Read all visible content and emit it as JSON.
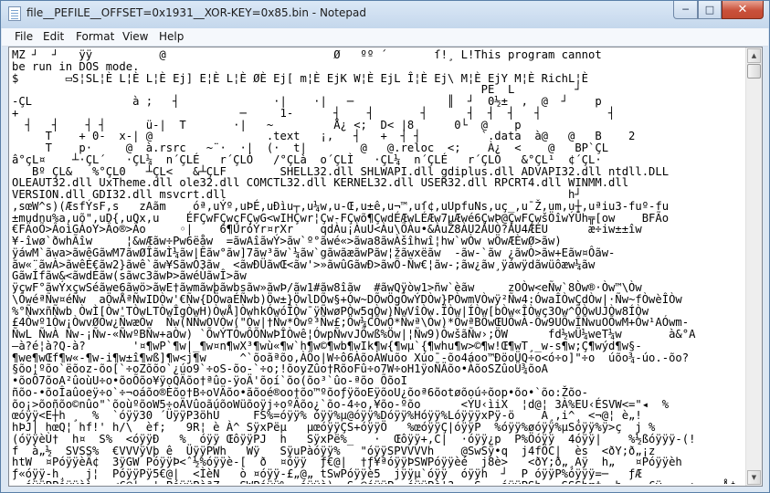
{
  "window": {
    "title": "file__PEFILE__OFFSET=0x1931__XOR-KEY=0x85.bin - Notepad",
    "controls": {
      "minimize": "─",
      "maximize": "□",
      "close": "✕"
    }
  },
  "menu": [
    "File",
    "Edit",
    "Format",
    "View",
    "Help"
  ],
  "document": {
    "lines": [
      "MZ ┘  ┘   ÿÿ          @                         Ø   ºº ´       ſ!¸ L!This program cannot",
      "be run in DOS mode.",
      "$       ▭S¦SL¦È L¦È L¦È Ej] E¦È L¦È ØÈ Ej[ m¦È EjK W¦È EjL Î¦È Ej\\ M¦È EjY M¦È RichL¦È",
      "                                                                      PE  L         ┘",
      "-ÇL               à ;   ┤              ·|    ·|   ─              ║  ┘  0½±  ,  @  ┘    p",
      "+                                 ─     1-      ┤    ┤       ┤      ┤  ┤  ┤   ┤          ┤",
      "  ┤   ┤    ┤ ┤      ü-|  T       ·|   ~         Å¿ <;  D< |8      0└  @    p",
      "     T    + 0-  x-| @                 .text   ¡,   ┤   +  ┤ ┤         `.data  à@   @   B    2",
      "     T    p·     @  à.rsrc   ~¨·  ·|  (·  t|        @   @.reloc  <;    À¿  <    @   BP`ÇL",
      "â°çL¤    ┴·ÇL´   ·ÇL¼  n´ÇLÉ   r´ÇLÓ   /°ÇLà  o´ÇLÌ   ·ÇL¼  n´ÇLÉ   r´ÇLÓ   &°ÇL¹  ¢´ÇL·",
      "   Bº ÇL&   %°ÇL0   ┴ÇL<   &┴ÇLF        SHELL32.dll SHLWAPI.dll gdiplus.dll ADVAPI32.dll ntdll.DLL",
      "OLEAUT32.dll UxTheme.dll ole32.dll COMCTL32.dll KERNEL32.dll USER32.dll RPCRT4.dll WINMM.dll",
      "VERSION.dll GDI32.dll msvcrt.dll                                                   h┘",
      ",sœW^s)(ÆsfÝsF,s   zAãm    óª,uÝº,uÞÉ,uÐìu┬,u¼w,u-Œ,u±ê,u¬™,uſ¢,uUpfuNs,uç_,u¯Ž,um,u┼,uªiu3-fuº-fu",
      "±mudnu%a,uõ\",uD{,uQx,u    ÉFÇwFÇwçFÇwG<wIHÇwr¦Çw-FÇwõ¶ÇwdÉÆwLÉÆw7µÆwé6ÇwÞ@ÇwFÇwšÖîwÝÜh╦[ow    BFÃo",
      "€FÄoÕ>ÂoìGÁoY>Âo®>Âo     ◦|    6¶UróÝr¤rXr    qdÀu¡ÀuU<Àu\\ÕÀu•&ÀuŽ8ÀU2ÀUÒ?ÀU4ÆÉU      æ÷iw±±îw",
      "¥-îwø`ðwhÃîw     ¦&wÆãw÷Pw6ëåw  =ãwAîãwÝ>ãw`º°ãwé«>ãwa8ãwÀšîhwî¦hw`wÒw wÖwÆÈwØ>ãw)",
      "ÿáwM`ãwa>ãwêGãwM7ãwØÎãwÌ¼ãw|Êãw°ãw]7ãw³ãw`¼ãw`gãwãæãwPãw¦žãwxëãw  -ãw-`ãw ¿ãwÒ>ãw+Eãw¤Ôãw-",
      "ãw«¨ãwÀ>ãwêÉ€ãw2}ãwê`ãw¥SãwÓ3ãw  <ãwÐÜãwŒ<ãw'>»ãwûGãwÐ>ãwÕ-Ñw€¦ãw-;ãw¿ãw¸ÿáwÿdãwüôæw¼ãw",
      "GãwÍfãw&<ãwdÉãw(sãwc3ãwÞ>ãwéÙãwÎ>ãw",
      "ÿçwF°ãwÝxçwSéãwe6ãwö>ãwE†ãwmãwþãwbsãw»ãwÞ/ãw1#ãw8îãw  #ãwQÿòw1>ñw`èãw     zOÒw<eÑw`8Òw®·Òw™\\Òw",
      "\\ÔwéªÑw¤éÑw  aÖwÅªÑwIDÒw'€Ñw{DÖwaÉÑwb)Öw±}ÖwlDÕw§+Ów~DÕwÖgÓwÝDÒw}PÒwmVÒwÿ²Ñw4:ÓwaÎÒwÇdÒw|·Ñw~fÒwèÎÒw",
      "%°ÑwxñÑwb ÒwÌ[Òw'TÒwLTÒwÎgÒwH)ÒwÅ]ÒwhkÓwóÎÒw¯ÿÑwøPÒw5qÒw)ÑwVîÒw.ÏÒw|ÍÒw[bÒw«ÎÒwç3Ow^ÕÒwUJÒw8ÍÒw",
      "£4Òwº1Òw¡ÒwvØÒw¿ÑwæÒw  Ñw(NÑwOVÒw(\"Òw|†Ñw*Òwº³Ñw£;Öw¼CÕwÓ*Ñwª\\Òw)*ÖwªBÖwŒUÖwÀ-Õw9UÕwÎÑwuOÕwM+Ów¹AÓwm-",
      "ÑwL ÑwÀ Ñw-¡Ñw-«ÑwºBÑw+aÒw) `ÕwÝTÒwÔÕNwÞÎÒwê¦ÓwpÑwvJÕwß%Öw|¦Ñw9)ÓwšãÑw›;ÖW      fd½wÜ¼weT¼w       à&°A",
      "—à?é¦à?Q-à?       '¤¶wP`¶w|_¶w¤n¶wX³¶wù«¶w`h¶w©¶wb¶wIk¶w{¶wµ`{¶whu¶w>©¶w!Œ¶wT¸_w-s¶w;Ç¶wýd¶w§-",
      "¶we¶wŒf¶w«-¶w-i¶w±î¶wß]¶w<j¶w     ^`õoãªõo,ÀÖo|W÷ô6ÀõoÀWuõo Xúo¯-õo4áoo™ÐöoÜQ÷o<ó÷o]\"÷o  úõo¾-úo.-õo?",
      "§õo¦ºõo`ëõoz-õo[`÷oZõõo`¿úo9`÷oS-õo-`÷o;!õoyZûo†RõoFû÷o7W÷oH1ÿoÑÄõo•ÀõoSZûoÜ¾õoA",
      "•õoÖ7õoA²ûoùU÷o•õoÕõo¥ÿoQÄõo†ªûo-ÿoÄ'õoí`õo(õo³`ûo-ªõo ÕõoI",
      "ñõo-•õoÎaûoeÿ÷o`÷¬oáõo®Èõo†B÷oVÄõo•ãõoé®oo†õo™ºõoƒÿõoEÿõoU¿õoª6õotøõoú÷õop•õo•`õo:Žõo-",
      "õo¡>õoñõo©nûo\"`õoùºõoW5÷oÄVûoãúõoWüõoÿj÷oºÄõo¿`õo-4÷o,¥õo-ºõo      <ÝU‹ìiX  ¦d@¦ 3À%EU‹ÉSVW<=\"◂  %",
      "œóÿÿ<E┼h ¸  %  `óÿÿ30 ´ÜÿÿP3öhÙ     FS%=óÿÿ% óÿÿ%µ@óÿÿ%Dóÿÿ%Hóÿÿ%LóÿÿÿxPÿ-ö    A¸,i^¸ <¬@¦ è„!",
      "hÞJ│ hœQ¦ hf!' h/\\  èf;   9R¦ è À^ SÿxPëµ   µœóÿÿÇS+óÿÿÖ   %œóÿÿÇ|óÿÿP  %óÿÿ%øóÿÿ%µSóÿÿ%ÿ>ç  j %",
      "(óÿÿèÙ†  h¤  S%  <óÿÿÐ   %  óÿÿ ŒôÿÿPJ  h   SÿxPë%_   ·  Œôÿÿ+,C|  ·óÿÿ¿p  P%Öóÿÿ  4óÿÿ|    %½ßóÿÿÿ-(!",
      "f  à„½  SVSS%  €VVVÿVþ ê  ÜÿÿPWh   Wÿ   SÿuPàóÿÿ%   \"óÿÿSPVVVVh    @SwSÿ•q  j4fÖC|  ès  <ðY;ð„¡z",
      "htW  ¤PóÿÿèÄ¢  3ÿGW PóÿÿÞ<ˆ½%óÿÿè-[  ð  ¤óÿÿ  ƒ€@|  †ƒ¥ªóÿÿÞSWPóÿÿèé  j8è>   <ðY;ð„¸Aÿ  h„   ¤Póÿÿèh",
      "ƒ«óÿÿ-h¸   j¦  PóÿÿPÿ5€@|  <ÌèN   ò ¤óÿÿ-£„@„ tSwPóÿÿè5  jÿÿµ`óÿÿ  óÿÿh  ┘  P óÿÿP%óÿÿÿ=─   ƒÆ",
      "  óÿÿPPóÿÿèì   <€@|  ¦ PóÿÿPèªZ   SWPóÿÿ%  óÿÿè)  S @óÿÿP  óÿÿPè¦?   S   óÿÿPSh╶¸ SSShœ‡  h    €ÿ-¸  +    Å¢"
    ]
  }
}
